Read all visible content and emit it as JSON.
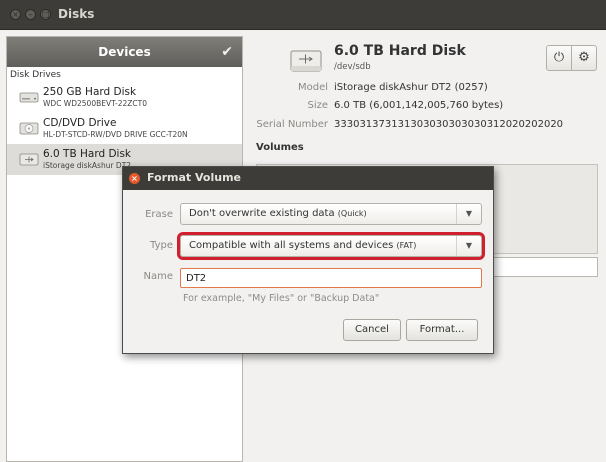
{
  "window": {
    "title": "Disks"
  },
  "sidebar": {
    "header": "Devices",
    "section_label": "Disk Drives",
    "drives": [
      {
        "name": "250 GB Hard Disk",
        "subtitle": "WDC WD2500BEVT-22ZCT0",
        "icon": "hard-disk-icon"
      },
      {
        "name": "CD/DVD Drive",
        "subtitle": "HL-DT-STCD-RW/DVD DRIVE GCC-T20N",
        "icon": "optical-drive-icon"
      },
      {
        "name": "6.0 TB Hard Disk",
        "subtitle": "iStorage diskAshur DT2",
        "icon": "usb-drive-icon"
      }
    ]
  },
  "detail": {
    "title": "6.0 TB Hard Disk",
    "device": "/dev/sdb",
    "properties": [
      {
        "label": "Model",
        "value": "iStorage diskAshur DT2 (0257)"
      },
      {
        "label": "Size",
        "value": "6.0 TB (6,001,142,005,760 bytes)"
      },
      {
        "label": "Serial Number",
        "value": "333031373131303030303030312020202020"
      }
    ],
    "volumes_label": "Volumes"
  },
  "dialog": {
    "title": "Format Volume",
    "erase_label": "Erase",
    "erase_value": "Don't overwrite existing data",
    "erase_note": "(Quick)",
    "type_label": "Type",
    "type_value": "Compatible with all systems and devices",
    "type_note": "(FAT)",
    "name_label": "Name",
    "name_value": "DT2",
    "hint": "For example, \"My Files\" or \"Backup Data\"",
    "cancel_label": "Cancel",
    "format_label": "Format..."
  },
  "colors": {
    "highlight": "#d0202d",
    "close_button": "#e5592c",
    "titlebar": "#3d3c38"
  }
}
